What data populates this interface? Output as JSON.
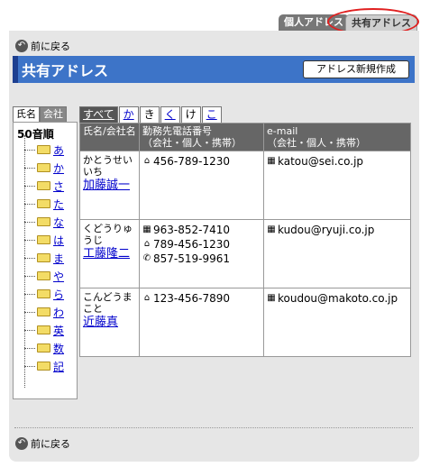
{
  "top_tabs": {
    "personal": "個人アドレス",
    "shared": "共有アドレス"
  },
  "back": "前に戻る",
  "title": "共有アドレス",
  "new_button": "アドレス新規作成",
  "side_tabs": [
    "氏名",
    "会社"
  ],
  "tree": {
    "root": "50音順",
    "items": [
      "あ",
      "か",
      "さ",
      "た",
      "な",
      "は",
      "ま",
      "や",
      "ら",
      "わ",
      "英",
      "数",
      "記"
    ]
  },
  "kana_tabs": [
    "すべて",
    "か",
    "き",
    "く",
    "け",
    "こ"
  ],
  "table": {
    "headers": [
      "氏名/会社名",
      "勤務先電話番号\n（会社・個人・携帯）",
      "e-mail\n（会社・個人・携帯）"
    ],
    "rows": [
      {
        "kana": "かとうせいいち",
        "name": "加藤誠一",
        "phones": [
          {
            "icon": "home-icon",
            "value": "456-789-1230"
          }
        ],
        "email": "katou@sei.co.jp"
      },
      {
        "kana": "くどうりゅうじ",
        "name": "工藤隆二",
        "phones": [
          {
            "icon": "building-icon",
            "value": "963-852-7410"
          },
          {
            "icon": "home-icon",
            "value": "789-456-1230"
          },
          {
            "icon": "mobile-icon",
            "value": "857-519-9961"
          }
        ],
        "email": "kudou@ryuji.co.jp"
      },
      {
        "kana": "こんどうまこと",
        "name": "近藤真",
        "phones": [
          {
            "icon": "home-icon",
            "value": "123-456-7890"
          }
        ],
        "email": "koudou@makoto.co.jp"
      }
    ]
  }
}
